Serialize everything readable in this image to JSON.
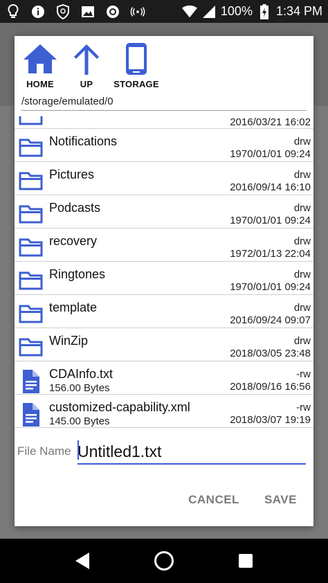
{
  "status_bar": {
    "battery_percent": "100%",
    "time": "1:34 PM",
    "icons": [
      "lightbulb-icon",
      "info-icon",
      "shield-icon",
      "image-icon",
      "record-icon",
      "radio-icon",
      "wifi-icon",
      "signal-icon",
      "battery-charging-icon"
    ]
  },
  "toolbar": {
    "home_label": "HOME",
    "up_label": "UP",
    "storage_label": "STORAGE"
  },
  "path": "/storage/emulated/0",
  "files": [
    {
      "name": "",
      "perm": "",
      "date": "2016/03/21 16:02",
      "type": "folder",
      "partial": true
    },
    {
      "name": "Notifications",
      "perm": "drw",
      "date": "1970/01/01 09:24",
      "type": "folder"
    },
    {
      "name": "Pictures",
      "perm": "drw",
      "date": "2016/09/14 16:10",
      "type": "folder"
    },
    {
      "name": "Podcasts",
      "perm": "drw",
      "date": "1970/01/01 09:24",
      "type": "folder"
    },
    {
      "name": "recovery",
      "perm": "drw",
      "date": "1972/01/13 22:04",
      "type": "folder"
    },
    {
      "name": "Ringtones",
      "perm": "drw",
      "date": "1970/01/01 09:24",
      "type": "folder"
    },
    {
      "name": "template",
      "perm": "drw",
      "date": "2016/09/24 09:07",
      "type": "folder"
    },
    {
      "name": "WinZip",
      "perm": "drw",
      "date": "2018/03/05 23:48",
      "type": "folder"
    },
    {
      "name": "CDAInfo.txt",
      "perm": "-rw",
      "date": "2018/09/16 16:56",
      "size": "156.00 Bytes",
      "type": "file"
    },
    {
      "name": "customized-capability.xml",
      "perm": "-rw",
      "date": "2018/03/07 19:19",
      "size": "145.00 Bytes",
      "type": "file"
    }
  ],
  "file_name": {
    "label": "File Name",
    "value": "Untitled1.txt"
  },
  "actions": {
    "cancel": "CANCEL",
    "save": "SAVE"
  },
  "colors": {
    "accent": "#3b5bd6",
    "icon_blue": "#3d5fd2"
  }
}
